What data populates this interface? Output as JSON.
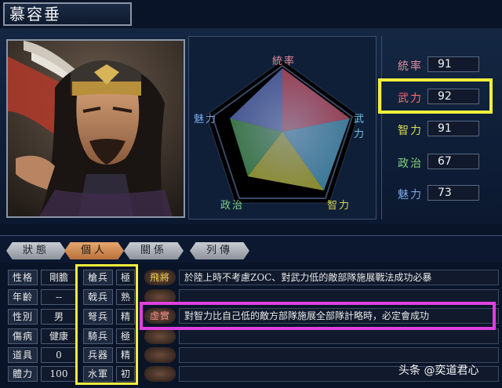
{
  "officer_name": "慕容垂",
  "radar": {
    "labels": {
      "tongshuai": "統率",
      "wuli": "武力",
      "zhili": "智力",
      "zhengzhi": "政治",
      "meili": "魅力"
    },
    "colors": {
      "tongshuai": "#e48c9a",
      "wuli": "#6fc4e8",
      "zhili": "#d8d84a",
      "zhengzhi": "#7fd67f",
      "meili": "#7aa7e6"
    }
  },
  "stats": [
    {
      "label": "統率",
      "value": "91",
      "color": "#e48c9a"
    },
    {
      "label": "武力",
      "value": "92",
      "color": "#ff6a6a"
    },
    {
      "label": "智力",
      "value": "91",
      "color": "#d8d84a"
    },
    {
      "label": "政治",
      "value": "67",
      "color": "#7fd67f"
    },
    {
      "label": "魅力",
      "value": "73",
      "color": "#7aa7e6"
    }
  ],
  "tabs": [
    {
      "label": "狀態"
    },
    {
      "label": "個人"
    },
    {
      "label": "關係"
    },
    {
      "label": "列傳"
    }
  ],
  "attributes": [
    {
      "label": "性格",
      "value": "剛膽"
    },
    {
      "label": "年齡",
      "value": "--"
    },
    {
      "label": "性別",
      "value": "男"
    },
    {
      "label": "傷病",
      "value": "健康"
    },
    {
      "label": "道具",
      "value": "0"
    },
    {
      "label": "體力",
      "value": "100"
    }
  ],
  "aptitudes": [
    {
      "label": "槍兵",
      "value": "極"
    },
    {
      "label": "戟兵",
      "value": "熟"
    },
    {
      "label": "弩兵",
      "value": "精"
    },
    {
      "label": "騎兵",
      "value": "極"
    },
    {
      "label": "兵器",
      "value": "精"
    },
    {
      "label": "水軍",
      "value": "初"
    }
  ],
  "skills": [
    {
      "tag": "飛將",
      "desc": "於陸上時不考慮ZOC、對武力低的敵部隊施展戰法成功必暴"
    },
    {
      "tag": "",
      "desc": ""
    },
    {
      "tag": "虚實",
      "desc": "對智力比自己低的敵方部隊施展全部隊計略時，必定會成功"
    },
    {
      "tag": "",
      "desc": ""
    },
    {
      "tag": "",
      "desc": ""
    },
    {
      "tag": "",
      "desc": ""
    }
  ],
  "watermark": "头条 @奕道君心"
}
